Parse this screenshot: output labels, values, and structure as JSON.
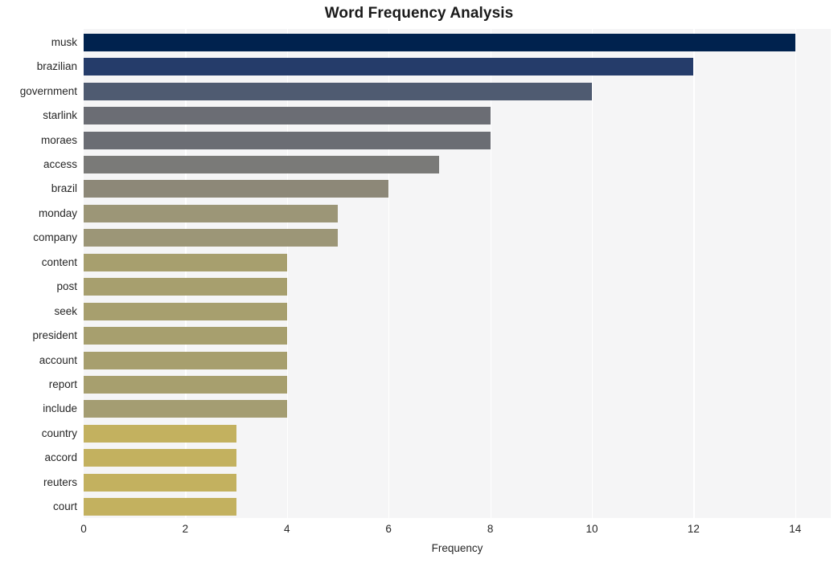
{
  "chart_data": {
    "type": "bar",
    "orientation": "horizontal",
    "title": "Word Frequency Analysis",
    "xlabel": "Frequency",
    "ylabel": "",
    "categories": [
      "musk",
      "brazilian",
      "government",
      "starlink",
      "moraes",
      "access",
      "brazil",
      "monday",
      "company",
      "content",
      "post",
      "seek",
      "president",
      "account",
      "report",
      "include",
      "country",
      "accord",
      "reuters",
      "court"
    ],
    "values": [
      14,
      12,
      10,
      8,
      8,
      7,
      6,
      5,
      5,
      4,
      4,
      4,
      4,
      4,
      4,
      4,
      3,
      3,
      3,
      3
    ],
    "bar_colors": [
      "#00224e",
      "#253c6a",
      "#4f5b71",
      "#6b6d74",
      "#6b6d74",
      "#7a7a78",
      "#8d8878",
      "#9c9677",
      "#9c9677",
      "#a79f6e",
      "#a79f6e",
      "#a79f6e",
      "#a79f6e",
      "#a79f6e",
      "#a79f6e",
      "#a49d72",
      "#c3b15f",
      "#c3b15f",
      "#c3b15f",
      "#c3b15f"
    ],
    "xlim": [
      0,
      14.7
    ],
    "xticks": [
      0,
      2,
      4,
      6,
      8,
      10,
      12,
      14
    ],
    "xtick_labels": [
      "0",
      "2",
      "4",
      "6",
      "8",
      "10",
      "12",
      "14"
    ],
    "grid": "vertical-only",
    "legend": "none",
    "plot_bgcolor": "#f5f5f6",
    "gridline_color": "#ffffff",
    "figure_bgcolor": "#ffffff",
    "text_color": "#262626",
    "colormap": "cividis"
  }
}
